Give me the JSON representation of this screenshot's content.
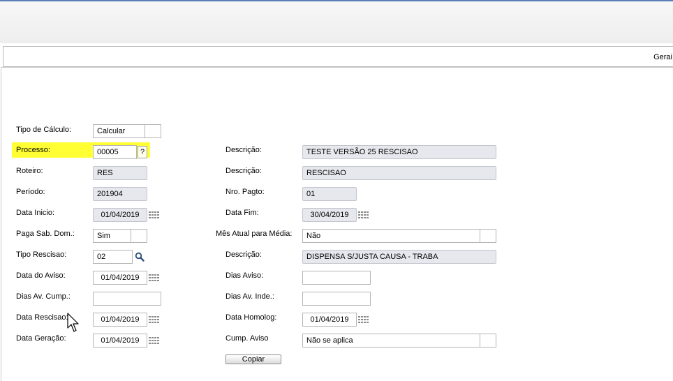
{
  "tab": {
    "label": "Gerai"
  },
  "left": {
    "tipo_calculo": {
      "label": "Tipo de Cálculo:",
      "value": "Calcular"
    },
    "processo": {
      "label": "Processo:",
      "value": "00005",
      "help": "?"
    },
    "roteiro": {
      "label": "Roteiro:",
      "value": "RES"
    },
    "periodo": {
      "label": "Período:",
      "value": "201904"
    },
    "data_inicio": {
      "label": "Data Inicio:",
      "value": "01/04/2019"
    },
    "paga_sab_dom": {
      "label": "Paga Sab. Dom.:",
      "value": "Sim"
    },
    "tipo_rescisao": {
      "label": "Tipo Rescisao:",
      "value": "02"
    },
    "data_aviso": {
      "label": "Data do Aviso:",
      "value": "01/04/2019"
    },
    "dias_av_cump": {
      "label": "Dias Av. Cump.:",
      "value": ""
    },
    "data_rescisao": {
      "label": "Data Rescisao:",
      "value": "01/04/2019"
    },
    "data_geracao": {
      "label": "Data Geração:",
      "value": "01/04/2019"
    }
  },
  "right": {
    "descricao1": {
      "label": "Descrição:",
      "value": "TESTE VERSÃO 25 RESCISAO"
    },
    "descricao2": {
      "label": "Descrição:",
      "value": "RESCISAO"
    },
    "nro_pagto": {
      "label": "Nro. Pagto:",
      "value": "01"
    },
    "data_fim": {
      "label": "Data Fim:",
      "value": "30/04/2019"
    },
    "mes_atual": {
      "label": "Mês Atual para Média:",
      "value": "Não"
    },
    "descricao3": {
      "label": "Descrição:",
      "value": "DISPENSA S/JUSTA CAUSA - TRABA"
    },
    "dias_aviso": {
      "label": "Dias Aviso:",
      "value": ""
    },
    "dias_av_inde": {
      "label": "Dias Av. Inde.:",
      "value": ""
    },
    "data_homolog": {
      "label": "Data Homolog:",
      "value": "01/04/2019"
    },
    "cump_aviso": {
      "label": "Cump. Aviso",
      "value": "Não se aplica"
    }
  },
  "copiar_button": {
    "label": "Copiar"
  },
  "colors": {
    "highlight": "#ffff33",
    "readonly_bg": "#e6e8ee",
    "top_border": "#5b7fb5"
  },
  "icons": [
    "calendar-icon",
    "search-icon",
    "mouse-cursor-icon"
  ]
}
